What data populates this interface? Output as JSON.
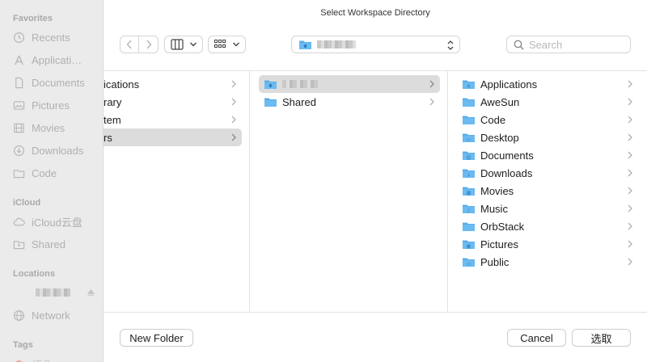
{
  "window": {
    "title": "Select Workspace Directory"
  },
  "sidebar": {
    "favorites_heading": "Favorites",
    "favorites": [
      {
        "label": "Recents",
        "icon": "clock-icon"
      },
      {
        "label": "Applicati…",
        "icon": "apps-icon"
      },
      {
        "label": "Documents",
        "icon": "document-icon"
      },
      {
        "label": "Pictures",
        "icon": "photo-icon"
      },
      {
        "label": "Movies",
        "icon": "film-icon"
      },
      {
        "label": "Downloads",
        "icon": "download-icon"
      },
      {
        "label": "Code",
        "icon": "folder-icon"
      }
    ],
    "icloud_heading": "iCloud",
    "icloud": [
      {
        "label": "iCloud云盘",
        "icon": "cloud-icon"
      },
      {
        "label": "Shared",
        "icon": "shared-folder-icon"
      }
    ],
    "locations_heading": "Locations",
    "locations": [
      {
        "label": "Network",
        "icon": "globe-icon"
      }
    ],
    "tags_heading": "Tags",
    "tags_partial": "红色"
  },
  "toolbar": {
    "search_placeholder": "Search"
  },
  "browser": {
    "column1": [
      "ications",
      "rary",
      "tem",
      "rs"
    ],
    "column2": [
      "Shared"
    ],
    "column3": [
      "Applications",
      "AweSun",
      "Code",
      "Desktop",
      "Documents",
      "Downloads",
      "Movies",
      "Music",
      "OrbStack",
      "Pictures",
      "Public"
    ]
  },
  "footer": {
    "new_folder": "New Folder",
    "cancel": "Cancel",
    "choose": "选取"
  },
  "colors": {
    "folder": "#5aaee8",
    "selection": "#dcdcdc",
    "sidebar_bg": "#ebebeb"
  }
}
